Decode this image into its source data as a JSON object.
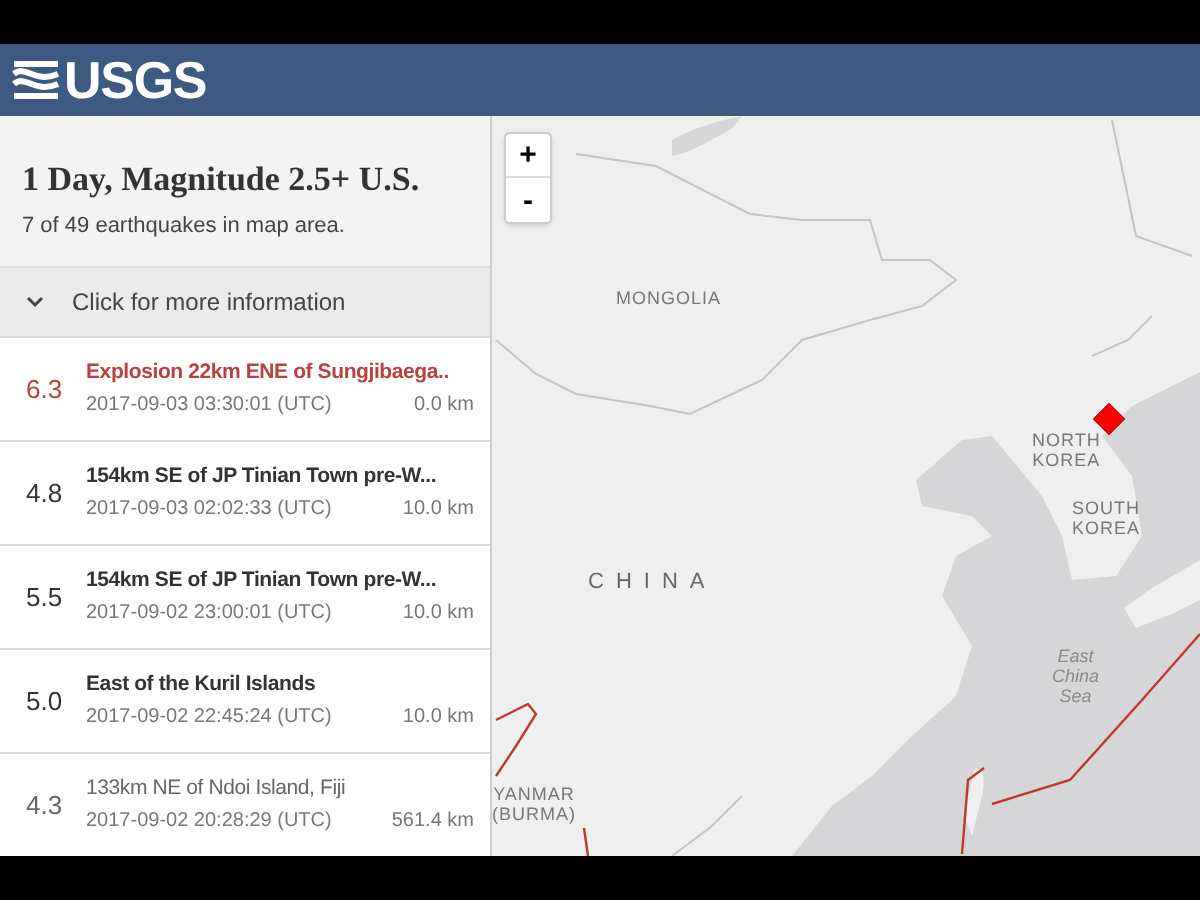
{
  "header": {
    "logo_text": "USGS"
  },
  "panel": {
    "title": "1 Day, Magnitude 2.5+ U.S.",
    "subtitle": "7 of 49 earthquakes in map area.",
    "more_info": {
      "label": "Click for more information",
      "expanded": false
    }
  },
  "events": [
    {
      "magnitude": "6.3",
      "title": "Explosion 22km ENE of Sungjibaega..",
      "time": "2017-09-03 03:30:01 (UTC)",
      "depth": "0.0 km",
      "selected": true,
      "dimmed": false
    },
    {
      "magnitude": "4.8",
      "title": "154km SE of JP Tinian Town pre-W...",
      "time": "2017-09-03 02:02:33 (UTC)",
      "depth": "10.0 km",
      "selected": false,
      "dimmed": false
    },
    {
      "magnitude": "5.5",
      "title": "154km SE of JP Tinian Town pre-W...",
      "time": "2017-09-02 23:00:01 (UTC)",
      "depth": "10.0 km",
      "selected": false,
      "dimmed": false
    },
    {
      "magnitude": "5.0",
      "title": "East of the Kuril Islands",
      "time": "2017-09-02 22:45:24 (UTC)",
      "depth": "10.0 km",
      "selected": false,
      "dimmed": false
    },
    {
      "magnitude": "4.3",
      "title": "133km NE of Ndoi Island, Fiji",
      "time": "2017-09-02 20:28:29 (UTC)",
      "depth": "561.4 km",
      "selected": false,
      "dimmed": true
    }
  ],
  "map": {
    "zoom_buttons": [
      "+",
      "-"
    ],
    "labels": [
      {
        "kind": "country",
        "lines": [
          "MONGOLIA"
        ]
      },
      {
        "kind": "country_large",
        "lines": [
          "CHINA"
        ]
      },
      {
        "kind": "country",
        "lines": [
          "NORTH",
          "KOREA"
        ]
      },
      {
        "kind": "country",
        "lines": [
          "SOUTH",
          "KOREA"
        ]
      },
      {
        "kind": "sea",
        "lines": [
          "East",
          "China",
          "Sea"
        ]
      },
      {
        "kind": "country",
        "lines": [
          "YANMAR",
          "(BURMA)"
        ]
      }
    ]
  }
}
